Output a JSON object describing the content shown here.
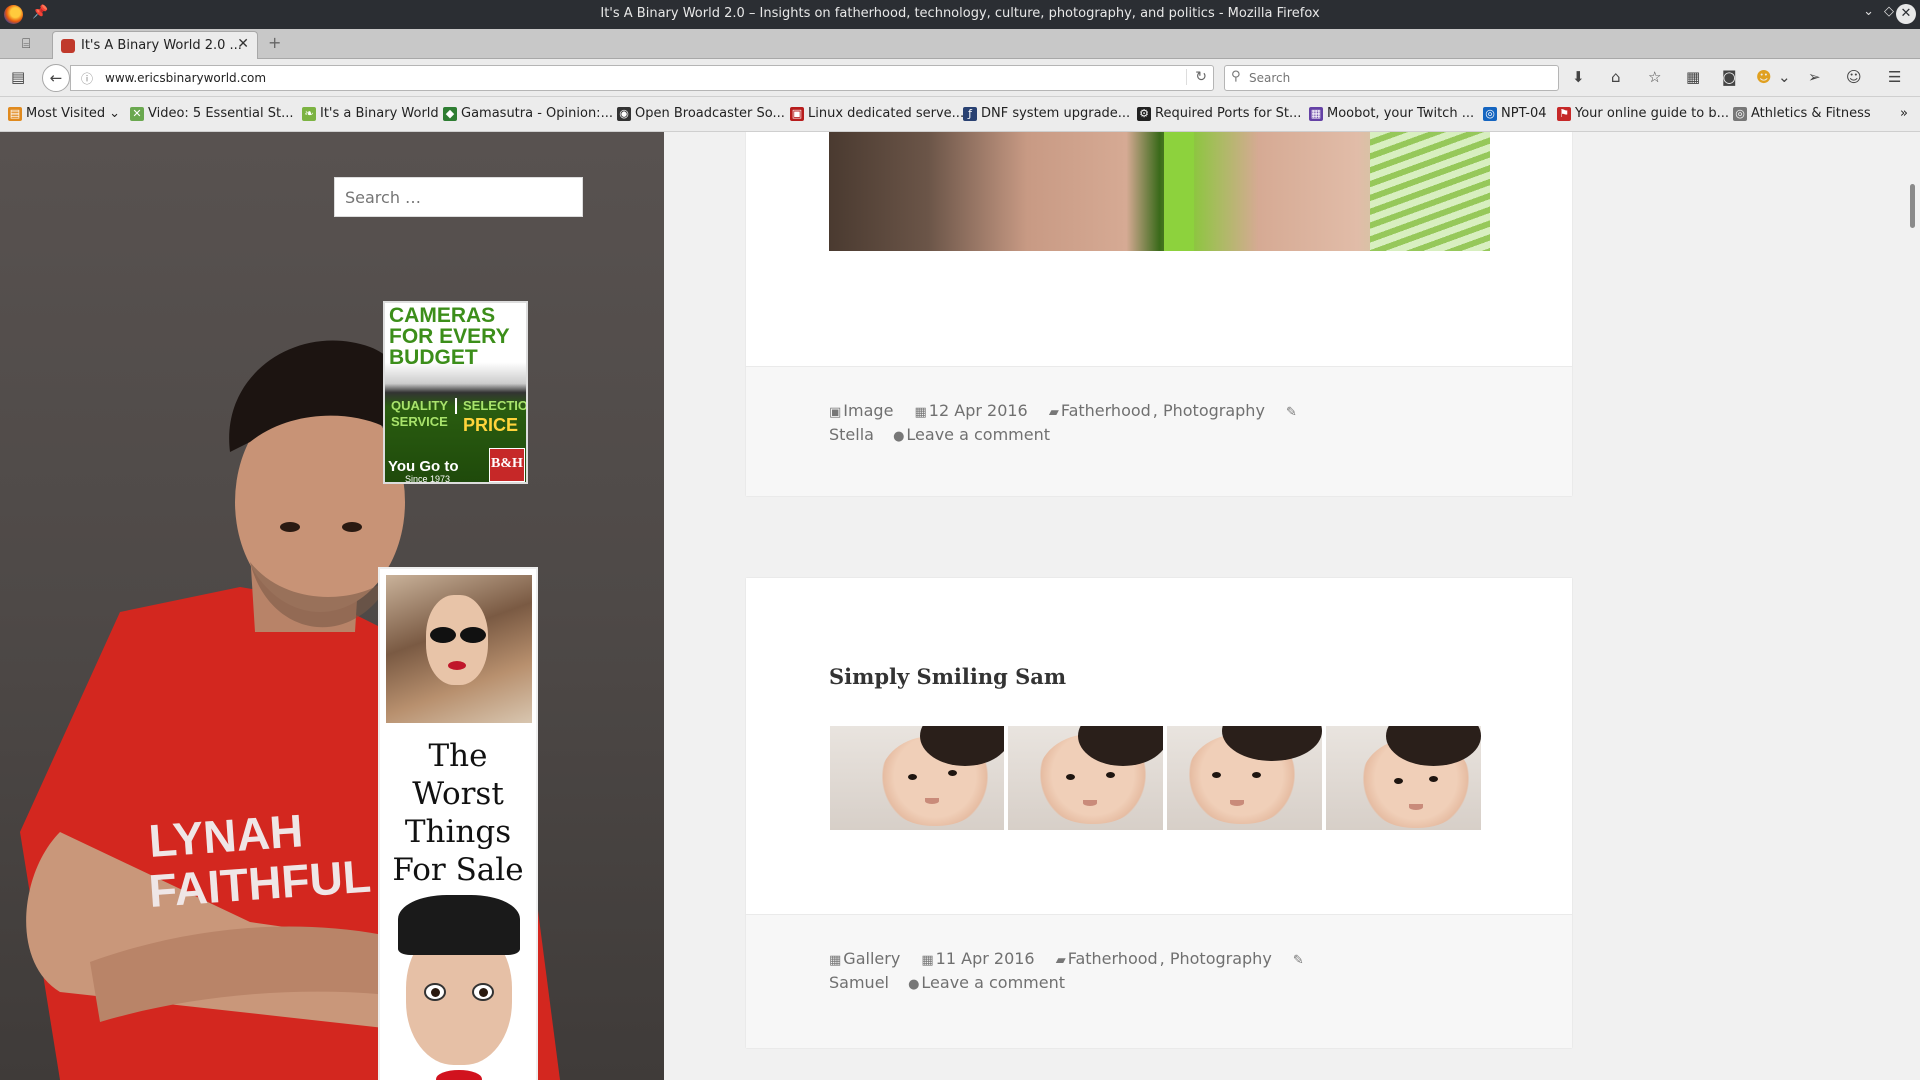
{
  "window": {
    "title": "It's A Binary World 2.0 – Insights on fatherhood, technology, culture, photography, and politics - Mozilla Firefox"
  },
  "tab": {
    "label": "It's A Binary World 2.0 ..."
  },
  "navbar": {
    "url": "www.ericsbinaryworld.com",
    "search_placeholder": "Search"
  },
  "bookmarks": [
    {
      "label": "Most Visited",
      "icon": "most-visited-icon",
      "color": "#e08a1e"
    },
    {
      "label": "Video: 5 Essential St...",
      "icon": "cross-icon",
      "color": "#6aa84f"
    },
    {
      "label": "It's a Binary World",
      "icon": "leaf-icon",
      "color": "#7cb342"
    },
    {
      "label": "Gamasutra - Opinion:...",
      "icon": "gamasutra-icon",
      "color": "#2e7d32"
    },
    {
      "label": "Open Broadcaster So...",
      "icon": "obs-icon",
      "color": "#333333"
    },
    {
      "label": "Linux dedicated serve...",
      "icon": "server-icon",
      "color": "#b71c1c"
    },
    {
      "label": "DNF system upgrade...",
      "icon": "fedora-icon",
      "color": "#294172"
    },
    {
      "label": "Required Ports for St...",
      "icon": "steam-icon",
      "color": "#222222"
    },
    {
      "label": "Moobot, your Twitch ...",
      "icon": "twitch-icon",
      "color": "#6441a5"
    },
    {
      "label": "NPT-04",
      "icon": "globe-icon",
      "color": "#1565c0"
    },
    {
      "label": "Your online guide to b...",
      "icon": "flag-icon",
      "color": "#c62828"
    },
    {
      "label": "Athletics & Fitness",
      "icon": "globe-icon",
      "color": "#777777"
    }
  ],
  "sidebar": {
    "search_placeholder": "Search …",
    "ad1": {
      "headline": "CAMERAS FOR EVERY BUDGET",
      "quality": "QUALITY SERVICE",
      "selection": "SELECTION",
      "price": "PRICE",
      "slogan": "You Go to",
      "since": "Since 1973",
      "brand": "B&H"
    },
    "ad2": {
      "text": "The Worst Things For Sale"
    }
  },
  "posts": [
    {
      "format": "Image",
      "date": "12 Apr 2016",
      "categories": [
        "Fatherhood",
        "Photography"
      ],
      "tag": "Stella",
      "comment": "Leave a comment"
    },
    {
      "title": "Simply Smiling Sam",
      "format": "Gallery",
      "date": "11 Apr 2016",
      "categories": [
        "Fatherhood",
        "Photography"
      ],
      "tag": "Samuel",
      "comment": "Leave a comment"
    }
  ]
}
